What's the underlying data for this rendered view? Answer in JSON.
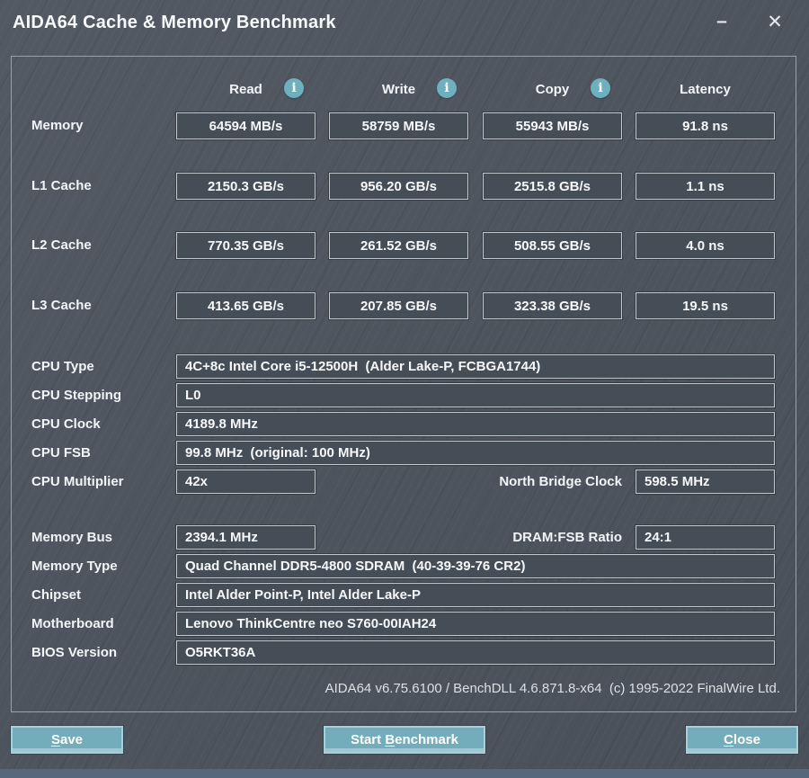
{
  "window": {
    "title": "AIDA64 Cache & Memory Benchmark",
    "minimize_glyph": "–",
    "close_glyph": "✕"
  },
  "colors": {
    "background": "#4d545e",
    "box_fill": "#454d57",
    "box_border": "#c3c8cd",
    "accent_teal": "#6fb0be",
    "button_teal": "#73acba",
    "bottom_strip": "#56687a"
  },
  "columns": {
    "read": {
      "label": "Read"
    },
    "write": {
      "label": "Write"
    },
    "copy": {
      "label": "Copy"
    },
    "latency": {
      "label": "Latency"
    },
    "info_icon_glyph": "i"
  },
  "benchmark": {
    "rows": [
      {
        "label": "Memory",
        "read": "64594 MB/s",
        "write": "58759 MB/s",
        "copy": "55943 MB/s",
        "latency": "91.8 ns"
      },
      {
        "label": "L1 Cache",
        "read": "2150.3 GB/s",
        "write": "956.20 GB/s",
        "copy": "2515.8 GB/s",
        "latency": "1.1 ns"
      },
      {
        "label": "L2 Cache",
        "read": "770.35 GB/s",
        "write": "261.52 GB/s",
        "copy": "508.55 GB/s",
        "latency": "4.0 ns"
      },
      {
        "label": "L3 Cache",
        "read": "413.65 GB/s",
        "write": "207.85 GB/s",
        "copy": "323.38 GB/s",
        "latency": "19.5 ns"
      }
    ]
  },
  "system_info": {
    "cpu_type": {
      "label": "CPU Type",
      "value": "4C+8c Intel Core i5-12500H  (Alder Lake-P, FCBGA1744)"
    },
    "cpu_stepping": {
      "label": "CPU Stepping",
      "value": "L0"
    },
    "cpu_clock": {
      "label": "CPU Clock",
      "value": "4189.8 MHz"
    },
    "cpu_fsb": {
      "label": "CPU FSB",
      "value": "99.8 MHz  (original: 100 MHz)"
    },
    "cpu_multiplier": {
      "label": "CPU Multiplier",
      "value": "42x"
    },
    "north_bridge_clock": {
      "label": "North Bridge Clock",
      "value": "598.5 MHz"
    },
    "memory_bus": {
      "label": "Memory Bus",
      "value": "2394.1 MHz"
    },
    "dram_fsb_ratio": {
      "label": "DRAM:FSB Ratio",
      "value": "24:1"
    },
    "memory_type": {
      "label": "Memory Type",
      "value": "Quad Channel DDR5-4800 SDRAM  (40-39-39-76 CR2)"
    },
    "chipset": {
      "label": "Chipset",
      "value": "Intel Alder Point-P, Intel Alder Lake-P"
    },
    "motherboard": {
      "label": "Motherboard",
      "value": "Lenovo ThinkCentre neo S760-00IAH24"
    },
    "bios_version": {
      "label": "BIOS Version",
      "value": "O5RKT36A"
    }
  },
  "footer": {
    "text": "AIDA64 v6.75.6100 / BenchDLL 4.6.871.8-x64  (c) 1995-2022 FinalWire Ltd."
  },
  "buttons": {
    "save": {
      "pre": "",
      "mnemonic": "S",
      "post": "ave"
    },
    "start_benchmark": {
      "pre": "Start ",
      "mnemonic": "B",
      "post": "enchmark"
    },
    "close": {
      "pre": "",
      "mnemonic": "C",
      "post": "lose"
    }
  }
}
